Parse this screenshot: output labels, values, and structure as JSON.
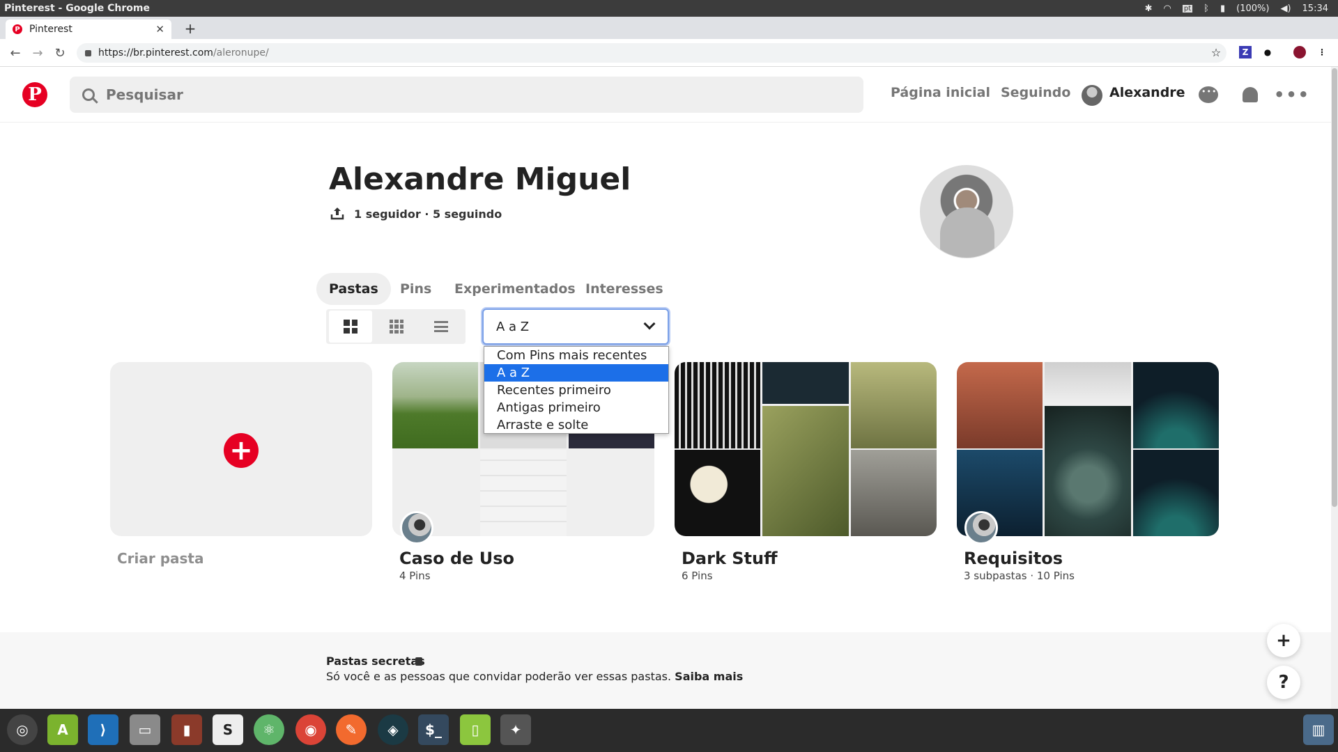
{
  "window": {
    "title": "Pinterest - Google Chrome"
  },
  "tray": {
    "keyboard": "pt",
    "battery": "(100%)",
    "time": "15:34"
  },
  "browser": {
    "tab_title": "Pinterest",
    "url_host": "https://br.pinterest.com",
    "url_path": "/aleronupe/"
  },
  "header": {
    "search_placeholder": "Pesquisar",
    "home": "Página inicial",
    "following": "Seguindo",
    "user": "Alexandre"
  },
  "profile": {
    "name": "Alexandre Miguel",
    "stats": "1 seguidor · 5 seguindo"
  },
  "tabs": [
    {
      "label": "Pastas",
      "active": true
    },
    {
      "label": "Pins",
      "active": false
    },
    {
      "label": "Experimentados",
      "active": false
    },
    {
      "label": "Interesses",
      "active": false
    }
  ],
  "sort": {
    "selected": "A a Z",
    "options": [
      "Com Pins mais recentes",
      "A a Z",
      "Recentes primeiro",
      "Antigas primeiro",
      "Arraste e solte"
    ]
  },
  "boards": {
    "create_label": "Criar pasta",
    "items": [
      {
        "title": "Caso de Uso",
        "count": "4 Pins"
      },
      {
        "title": "Dark Stuff",
        "count": "6 Pins"
      },
      {
        "title": "Requisitos",
        "count": "3 subpastas · 10 Pins"
      }
    ]
  },
  "secret": {
    "title": "Pastas secretas",
    "text": "Só você e as pessoas que convidar poderão ver essas pastas.",
    "link": "Saiba mais"
  },
  "fabs": {
    "add": "+",
    "help": "?"
  },
  "taskbar": [
    "ubuntu",
    "android-studio",
    "vscode",
    "files",
    "book",
    "slack",
    "atom",
    "chrome",
    "postman",
    "gitkraken",
    "terminal",
    "app",
    "gimp"
  ]
}
